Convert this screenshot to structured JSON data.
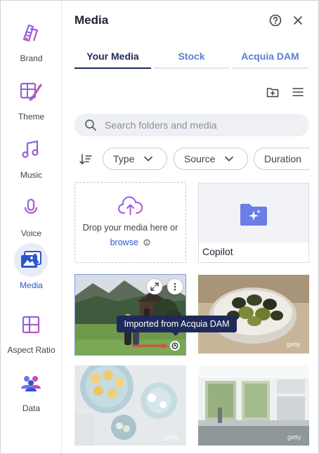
{
  "sidebar": {
    "items": [
      {
        "label": "Brand",
        "icon": "palette-icon"
      },
      {
        "label": "Theme",
        "icon": "theme-icon"
      },
      {
        "label": "Music",
        "icon": "music-note-icon"
      },
      {
        "label": "Voice",
        "icon": "microphone-icon"
      },
      {
        "label": "Media",
        "icon": "media-icon",
        "active": true
      },
      {
        "label": "Aspect Ratio",
        "icon": "aspect-ratio-icon"
      },
      {
        "label": "Data",
        "icon": "people-icon"
      }
    ]
  },
  "panel": {
    "title": "Media",
    "tabs": [
      {
        "label": "Your Media",
        "active": true
      },
      {
        "label": "Stock"
      },
      {
        "label": "Acquia DAM"
      }
    ],
    "search": {
      "placeholder": "Search folders and media",
      "value": ""
    },
    "filters": [
      "Type",
      "Source",
      "Duration"
    ],
    "drop_zone": {
      "line1": "Drop your media here or",
      "link": "browse"
    },
    "folder": {
      "name": "Copilot"
    },
    "tooltip": "Imported from Acquia DAM",
    "watermark": "getty"
  },
  "colors": {
    "accent": "#2b58c6",
    "brand_purple": "#6a5fd6",
    "tab_active": "#1f2a5a",
    "tooltip_bg": "#1f2a5a"
  }
}
